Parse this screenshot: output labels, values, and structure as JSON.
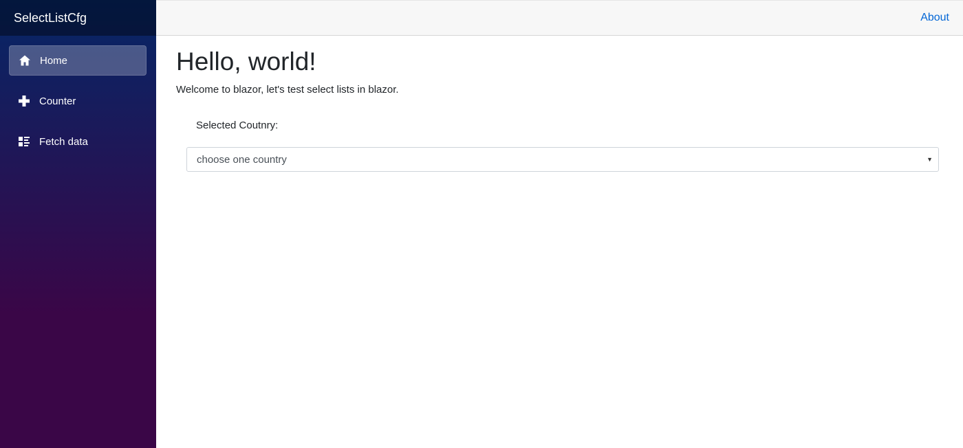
{
  "app": {
    "brand": "SelectListCfg"
  },
  "sidebar": {
    "items": [
      {
        "label": "Home",
        "icon": "home-icon",
        "active": true
      },
      {
        "label": "Counter",
        "icon": "plus-icon",
        "active": false
      },
      {
        "label": "Fetch data",
        "icon": "list-rich-icon",
        "active": false
      }
    ]
  },
  "topbar": {
    "about_label": "About"
  },
  "main": {
    "heading": "Hello, world!",
    "welcome": "Welcome to blazor, let's test select lists in blazor.",
    "country_label": "Selected Coutnry:",
    "country_select": {
      "selected": "choose one country"
    }
  },
  "colors": {
    "sidebar_top": "#052767",
    "sidebar_bottom": "#3a0647",
    "link": "#0366d6",
    "topbar_bg": "#f7f7f7"
  }
}
